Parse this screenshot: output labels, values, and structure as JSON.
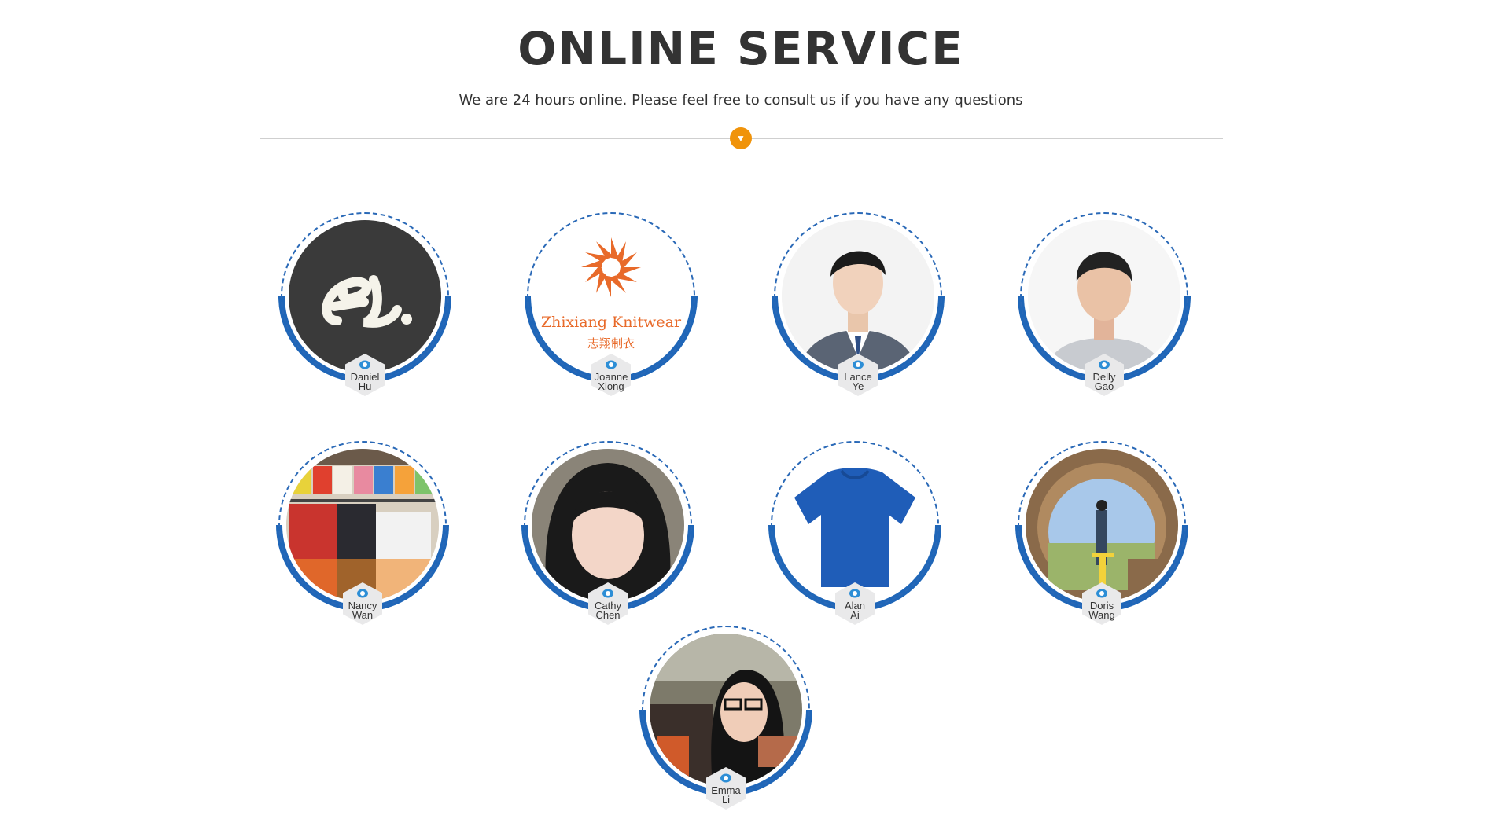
{
  "header": {
    "title": "ONLINE SERVICE",
    "subtitle": "We are 24 hours online. Please feel free to consult us if you have any questions",
    "accent_color": "#f0930a",
    "ring_color": "#1f66b8"
  },
  "contacts": [
    {
      "first": "Daniel",
      "last": "Hu",
      "avatar": "alibaba-logo-avatar"
    },
    {
      "first": "Joanne",
      "last": "Xiong",
      "avatar": "zhixiang-knitwear-logo-avatar",
      "logo_text": "Zhixiang Knitwear",
      "logo_sub": "志翔制衣"
    },
    {
      "first": "Lance",
      "last": "Ye",
      "avatar": "man-in-suit-photo"
    },
    {
      "first": "Delly",
      "last": "Gao",
      "avatar": "man-portrait-photo"
    },
    {
      "first": "Nancy",
      "last": "Wan",
      "avatar": "clothing-rack-photo"
    },
    {
      "first": "Cathy",
      "last": "Chen",
      "avatar": "woman-portrait-photo"
    },
    {
      "first": "Alan",
      "last": "Ai",
      "avatar": "blue-tshirt-photo"
    },
    {
      "first": "Doris",
      "last": "Wang",
      "avatar": "woman-in-field-photo"
    },
    {
      "first": "Emma",
      "last": "Li",
      "avatar": "woman-with-glasses-photo"
    }
  ]
}
